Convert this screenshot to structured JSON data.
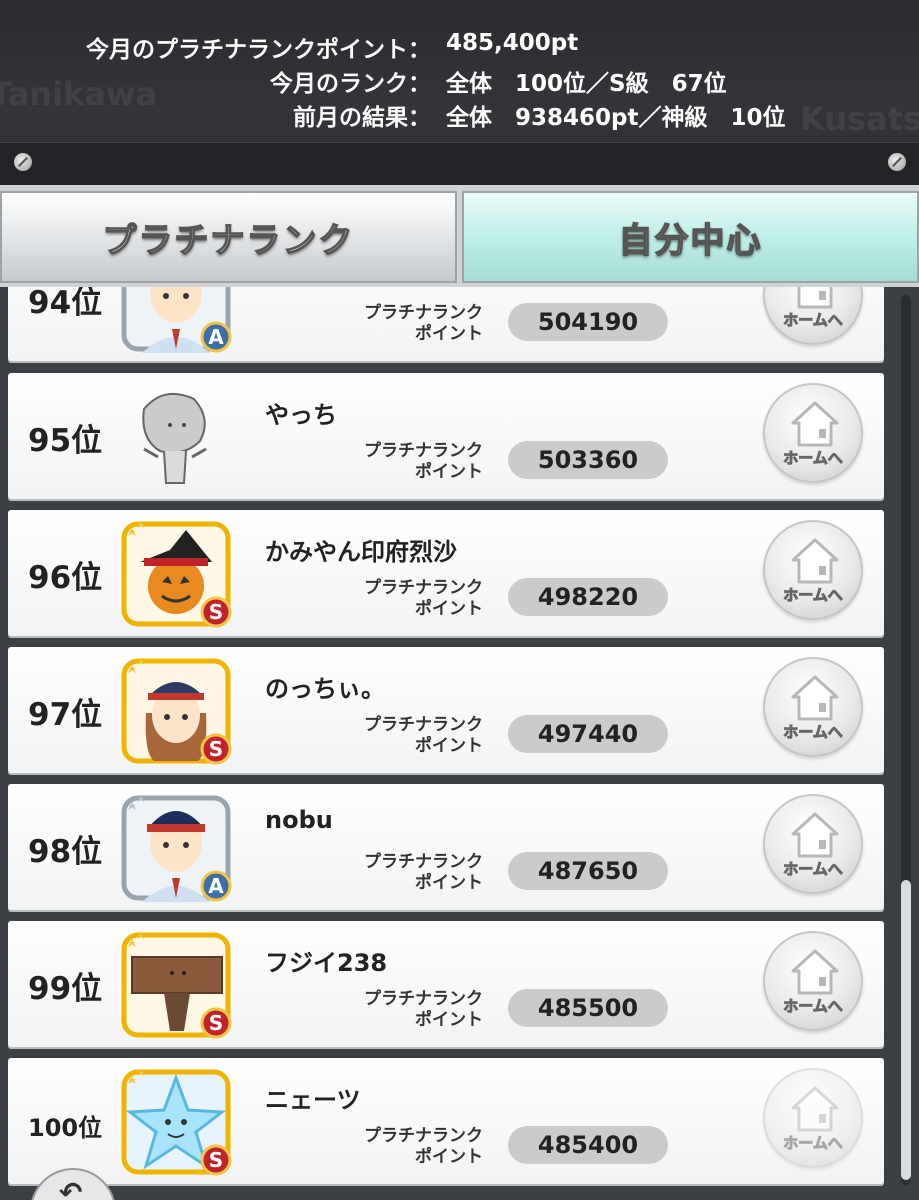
{
  "header": {
    "monthly_points_label": "今月のプラチナランクポイント：",
    "monthly_points_value": "485,400pt",
    "monthly_rank_label": "今月のランク：",
    "monthly_rank_value": "全体　100位／S級　67位",
    "last_month_label": "前月の結果：",
    "last_month_value": "全体　938460pt／神級　10位",
    "bg_text_left": "Tanikawa",
    "bg_text_right": "Kusatsu"
  },
  "tabs": {
    "platinum_rank": "プラチナランク",
    "self_centered": "自分中心"
  },
  "rows": [
    {
      "rank": "94位",
      "name": "",
      "points_label_1": "プラチナランク",
      "points_label_2": "ポイント",
      "points": "504190",
      "home": "ホームへ",
      "avatar": "conductor-avatar-icon"
    },
    {
      "rank": "95位",
      "name": "やっち",
      "points_label_1": "プラチナランク",
      "points_label_2": "ポイント",
      "points": "503360",
      "home": "ホームへ",
      "avatar": "stone-figure-avatar-icon"
    },
    {
      "rank": "96位",
      "name": "かみやん印府烈沙",
      "points_label_1": "プラチナランク",
      "points_label_2": "ポイント",
      "points": "498220",
      "home": "ホームへ",
      "avatar": "pumpkin-witch-avatar-icon"
    },
    {
      "rank": "97位",
      "name": "のっちぃ。",
      "points_label_1": "プラチナランク",
      "points_label_2": "ポイント",
      "points": "497440",
      "home": "ホームへ",
      "avatar": "female-conductor-avatar-icon"
    },
    {
      "rank": "98位",
      "name": "nobu",
      "points_label_1": "プラチナランク",
      "points_label_2": "ポイント",
      "points": "487650",
      "home": "ホームへ",
      "avatar": "conductor-avatar-icon"
    },
    {
      "rank": "99位",
      "name": "フジイ238",
      "points_label_1": "プラチナランク",
      "points_label_2": "ポイント",
      "points": "485500",
      "home": "ホームへ",
      "avatar": "wooden-board-avatar-icon"
    },
    {
      "rank": "100位",
      "name": "ニェーツ",
      "points_label_1": "プラチナランク",
      "points_label_2": "ポイント",
      "points": "485400",
      "home": "ホームへ",
      "avatar": "star-avatar-icon"
    }
  ],
  "badges": {
    "s": "S",
    "a": "A"
  },
  "colors": {
    "header_bg": "#2f3134",
    "tab_active": "#c2f0ea",
    "list_bg": "#3c3f44",
    "gold_frame": "#f0b400",
    "silver_frame": "#9aa3ab"
  }
}
